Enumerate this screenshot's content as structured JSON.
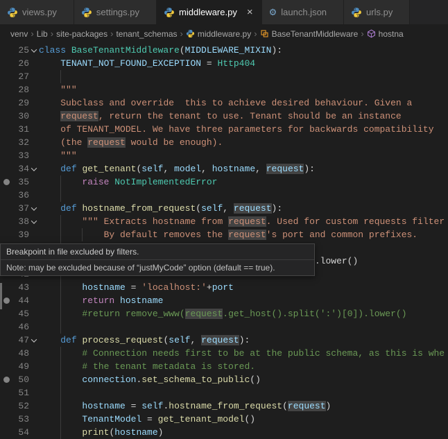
{
  "colors": {
    "keyword": "#569cd6",
    "control": "#c586c0",
    "class_type": "#4ec9b0",
    "function": "#dcdcaa",
    "variable": "#9cdcfe",
    "string": "#ce9178",
    "comment": "#6a9955",
    "plain": "#d4d4d4",
    "line_number": "#858585",
    "word_highlight": "rgba(99,99,99,0.55)",
    "breakpoint_gray": "#848484",
    "python_icon_blue": "#4e8cbf",
    "python_icon_yellow": "#f0c93d",
    "class_icon_orange": "#ee9d28",
    "method_icon_purple": "#b180d7",
    "gear_icon_blue": "#7aa7cc"
  },
  "tabs": [
    {
      "label": "views.py",
      "icon": "python",
      "active": false
    },
    {
      "label": "settings.py",
      "icon": "python",
      "active": false
    },
    {
      "label": "middleware.py",
      "icon": "python",
      "active": true,
      "close": "×"
    },
    {
      "label": "launch.json",
      "icon": "gear",
      "active": false
    },
    {
      "label": "urls.py",
      "icon": "python",
      "active": false
    }
  ],
  "breadcrumb": [
    {
      "label": "venv"
    },
    {
      "label": "Lib"
    },
    {
      "label": "site-packages"
    },
    {
      "label": "tenant_schemas"
    },
    {
      "label": "middleware.py",
      "icon": "python"
    },
    {
      "label": "BaseTenantMiddleware",
      "icon": "class"
    },
    {
      "label": "hostna",
      "icon": "method"
    }
  ],
  "tooltip": {
    "line1": "Breakpoint in file excluded by filters.",
    "line2": "Note: may be excluded because of “justMyCode” option (default == true)."
  },
  "editor": {
    "first_line": 25,
    "lines": [
      {
        "n": 25,
        "fold": true,
        "tokens": [
          [
            "kw",
            "class "
          ],
          [
            "cls",
            "BaseTenantMiddleware"
          ],
          [
            "pln",
            "("
          ],
          [
            "var",
            "MIDDLEWARE_MIXIN"
          ],
          [
            "pln",
            "):"
          ]
        ]
      },
      {
        "n": 26,
        "tokens": [
          [
            "pln",
            "    "
          ],
          [
            "var",
            "TENANT_NOT_FOUND_EXCEPTION"
          ],
          [
            "pln",
            " = "
          ],
          [
            "cls",
            "Http404"
          ]
        ]
      },
      {
        "n": 27,
        "tokens": []
      },
      {
        "n": 28,
        "tokens": [
          [
            "pln",
            "    "
          ],
          [
            "str",
            "\"\"\""
          ]
        ]
      },
      {
        "n": 29,
        "tokens": [
          [
            "pln",
            "    "
          ],
          [
            "str",
            "Subclass and override  this to achieve desired behaviour. Given a"
          ]
        ]
      },
      {
        "n": 30,
        "tokens": [
          [
            "pln",
            "    "
          ],
          [
            "str",
            "request",
            "hl"
          ],
          [
            "str",
            ", return the tenant to use. Tenant should be an instance"
          ]
        ]
      },
      {
        "n": 31,
        "tokens": [
          [
            "pln",
            "    "
          ],
          [
            "str",
            "of TENANT_MODEL. We have three parameters for backwards compatibility"
          ]
        ]
      },
      {
        "n": 32,
        "tokens": [
          [
            "pln",
            "    "
          ],
          [
            "str",
            "(the "
          ],
          [
            "str",
            "request",
            "hl"
          ],
          [
            "str",
            " would be enough)."
          ]
        ]
      },
      {
        "n": 33,
        "tokens": [
          [
            "pln",
            "    "
          ],
          [
            "str",
            "\"\"\""
          ]
        ]
      },
      {
        "n": 34,
        "fold": true,
        "tokens": [
          [
            "pln",
            "    "
          ],
          [
            "kw",
            "def "
          ],
          [
            "fn",
            "get_tenant"
          ],
          [
            "pln",
            "("
          ],
          [
            "var",
            "self"
          ],
          [
            "pln",
            ", "
          ],
          [
            "var",
            "model"
          ],
          [
            "pln",
            ", "
          ],
          [
            "var",
            "hostname"
          ],
          [
            "pln",
            ", "
          ],
          [
            "var",
            "request",
            "hl"
          ],
          [
            "pln",
            "):"
          ]
        ]
      },
      {
        "n": 35,
        "bp": true,
        "tokens": [
          [
            "pln",
            "        "
          ],
          [
            "ctrl",
            "raise "
          ],
          [
            "cls",
            "NotImplementedError"
          ]
        ]
      },
      {
        "n": 36,
        "tokens": []
      },
      {
        "n": 37,
        "fold": true,
        "tokens": [
          [
            "pln",
            "    "
          ],
          [
            "kw",
            "def "
          ],
          [
            "fn",
            "hostname_from_request"
          ],
          [
            "pln",
            "("
          ],
          [
            "var",
            "self"
          ],
          [
            "pln",
            ", "
          ],
          [
            "var",
            "request",
            "hl"
          ],
          [
            "pln",
            "):"
          ]
        ]
      },
      {
        "n": 38,
        "fold": true,
        "tokens": [
          [
            "pln",
            "        "
          ],
          [
            "str",
            "\"\"\" Extracts hostname from "
          ],
          [
            "str",
            "request",
            "hl"
          ],
          [
            "str",
            ". Used for custom requests filter"
          ]
        ]
      },
      {
        "n": 39,
        "tokens": [
          [
            "pln",
            "            "
          ],
          [
            "str",
            "By default removes the "
          ],
          [
            "str",
            "request",
            "hl"
          ],
          [
            "str",
            "'s port and common prefixes."
          ]
        ]
      },
      {
        "n": 40,
        "tokens": []
      },
      {
        "n": 41,
        "tokens": [
          [
            "pln",
            "                                                   "
          ],
          [
            "pln",
            ".lower()"
          ]
        ]
      },
      {
        "n": 42,
        "tokens": []
      },
      {
        "n": 43,
        "tokens": [
          [
            "pln",
            "        "
          ],
          [
            "var",
            "hostname"
          ],
          [
            "pln",
            " = "
          ],
          [
            "str",
            "'localhost:'"
          ],
          [
            "pln",
            "+"
          ],
          [
            "var",
            "port"
          ]
        ]
      },
      {
        "n": 44,
        "bp": true,
        "tokens": [
          [
            "pln",
            "        "
          ],
          [
            "ctrl",
            "return "
          ],
          [
            "var",
            "hostname"
          ]
        ]
      },
      {
        "n": 45,
        "tokens": [
          [
            "pln",
            "        "
          ],
          [
            "com",
            "#return remove_www("
          ],
          [
            "com",
            "request",
            "hl"
          ],
          [
            "com",
            ".get_host().split(':')[0]).lower()"
          ]
        ]
      },
      {
        "n": 46,
        "tokens": []
      },
      {
        "n": 47,
        "fold": true,
        "tokens": [
          [
            "pln",
            "    "
          ],
          [
            "kw",
            "def "
          ],
          [
            "fn",
            "process_request"
          ],
          [
            "pln",
            "("
          ],
          [
            "var",
            "self"
          ],
          [
            "pln",
            ", "
          ],
          [
            "var",
            "request",
            "hl"
          ],
          [
            "pln",
            "):"
          ]
        ]
      },
      {
        "n": 48,
        "tokens": [
          [
            "pln",
            "        "
          ],
          [
            "com",
            "# Connection needs first to be at the public schema, as this is whe"
          ]
        ]
      },
      {
        "n": 49,
        "tokens": [
          [
            "pln",
            "        "
          ],
          [
            "com",
            "# the tenant metadata is stored."
          ]
        ]
      },
      {
        "n": 50,
        "bp": true,
        "tokens": [
          [
            "pln",
            "        "
          ],
          [
            "var",
            "connection"
          ],
          [
            "pln",
            "."
          ],
          [
            "fn",
            "set_schema_to_public"
          ],
          [
            "pln",
            "()"
          ]
        ]
      },
      {
        "n": 51,
        "tokens": []
      },
      {
        "n": 52,
        "tokens": [
          [
            "pln",
            "        "
          ],
          [
            "var",
            "hostname"
          ],
          [
            "pln",
            " = "
          ],
          [
            "var",
            "self"
          ],
          [
            "pln",
            "."
          ],
          [
            "fn",
            "hostname_from_request"
          ],
          [
            "pln",
            "("
          ],
          [
            "var",
            "request",
            "hl"
          ],
          [
            "pln",
            ")"
          ]
        ]
      },
      {
        "n": 53,
        "tokens": [
          [
            "pln",
            "        "
          ],
          [
            "var",
            "TenantModel"
          ],
          [
            "pln",
            " = "
          ],
          [
            "fn",
            "get_tenant_model"
          ],
          [
            "pln",
            "()"
          ]
        ]
      },
      {
        "n": 54,
        "tokens": [
          [
            "pln",
            "        "
          ],
          [
            "fn",
            "print"
          ],
          [
            "pln",
            "("
          ],
          [
            "var",
            "hostname"
          ],
          [
            "pln",
            ")"
          ]
        ]
      }
    ]
  }
}
